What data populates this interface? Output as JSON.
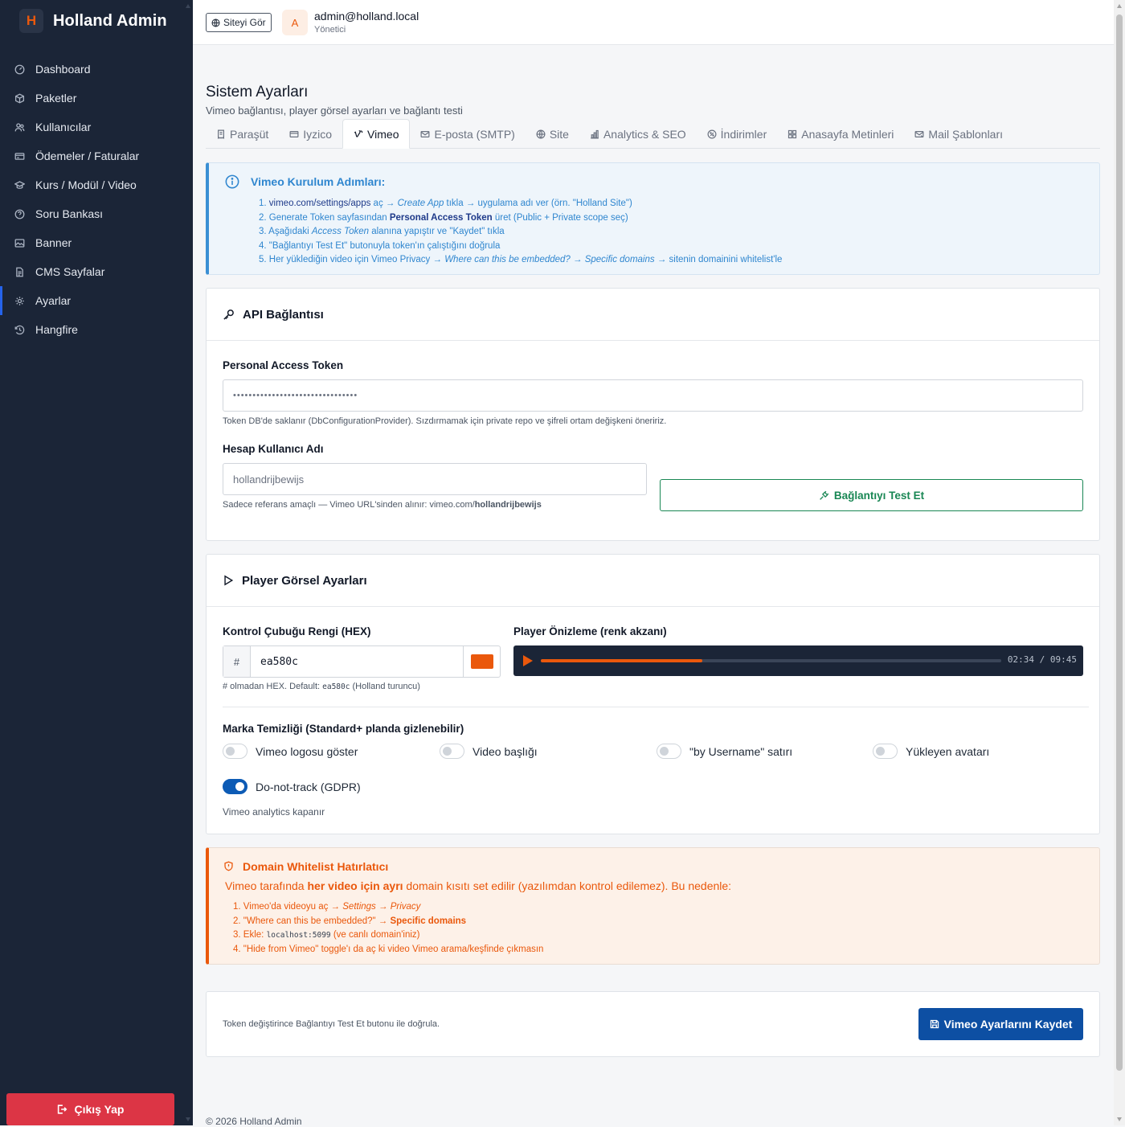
{
  "brand": {
    "logo_letter": "H",
    "name": "Holland Admin"
  },
  "sidebar": {
    "items": [
      {
        "label": "Dashboard",
        "icon": "speedometer-icon"
      },
      {
        "label": "Paketler",
        "icon": "box-icon"
      },
      {
        "label": "Kullanıcılar",
        "icon": "users-icon"
      },
      {
        "label": "Ödemeler / Faturalar",
        "icon": "credit-card-icon"
      },
      {
        "label": "Kurs / Modül / Video",
        "icon": "mortarboard-icon"
      },
      {
        "label": "Soru Bankası",
        "icon": "question-circle-icon"
      },
      {
        "label": "Banner",
        "icon": "image-icon"
      },
      {
        "label": "CMS Sayfalar",
        "icon": "file-text-icon"
      },
      {
        "label": "Ayarlar",
        "icon": "gear-icon",
        "active": true
      },
      {
        "label": "Hangfire",
        "icon": "clock-history-icon"
      }
    ],
    "logout_label": "Çıkış Yap"
  },
  "topbar": {
    "view_site_label": "Siteyi Gör",
    "avatar_letter": "A",
    "user_email": "admin@holland.local",
    "user_role": "Yönetici"
  },
  "page": {
    "title": "Sistem Ayarları",
    "subtitle": "Vimeo bağlantısı, player görsel ayarları ve bağlantı testi"
  },
  "tabs": [
    {
      "label": "Paraşüt",
      "icon": "receipt-icon"
    },
    {
      "label": "Iyzico",
      "icon": "credit-card-icon"
    },
    {
      "label": "Vimeo",
      "icon": "vimeo-icon",
      "active": true
    },
    {
      "label": "E-posta (SMTP)",
      "icon": "envelope-icon"
    },
    {
      "label": "Site",
      "icon": "globe-icon"
    },
    {
      "label": "Analytics & SEO",
      "icon": "bar-chart-icon"
    },
    {
      "label": "İndirimler",
      "icon": "percent-icon"
    },
    {
      "label": "Anasayfa Metinleri",
      "icon": "grid-icon"
    },
    {
      "label": "Mail Şablonları",
      "icon": "envelope-paper-icon"
    }
  ],
  "info": {
    "title": "Vimeo Kurulum Adımları:",
    "steps": {
      "s1": {
        "n": "1. ",
        "link": "vimeo.com/settings/apps",
        "a": " aç → ",
        "em": "Create App",
        "b": " tıkla → uygulama adı ver (örn. \"Holland Site\")"
      },
      "s2": {
        "n": "2. ",
        "a": "Generate Token sayfasından ",
        "strong": "Personal Access Token",
        "b": " üret (Public + Private scope seç)"
      },
      "s3": {
        "n": "3. ",
        "a": "Aşağıdaki ",
        "em": "Access Token",
        "b": " alanına yapıştır ve \"Kaydet\" tıkla"
      },
      "s4": {
        "n": "4. ",
        "a": "\"Bağlantıyı Test Et\" butonuyla token'ın çalıştığını doğrula"
      },
      "s5": {
        "n": "5. ",
        "a": "Her yüklediğin video için Vimeo Privacy → ",
        "em": "Where can this be embedded? → Specific domains",
        "b": " → sitenin domainini whitelist'le"
      }
    }
  },
  "api": {
    "title": "API Bağlantısı",
    "token_label": "Personal Access Token",
    "token_value": "••••••••••••••••••••••••••••••••",
    "token_hint": "Token DB'de saklanır (DbConfigurationProvider). Sızdırmamak için private repo ve şifreli ortam değişkeni öneririz.",
    "username_label": "Hesap Kullanıcı Adı",
    "username_value": "hollandrijbewijs",
    "username_hint_prefix": "Sadece referans amaçlı — Vimeo URL'sinden alınır: vimeo.com/",
    "username_hint_bold": "hollandrijbewijs",
    "test_button": "Bağlantıyı Test Et"
  },
  "player": {
    "title": "Player Görsel Ayarları",
    "color_label": "Kontrol Çubuğu Rengi (HEX)",
    "hex_prefix": "#",
    "hex_value": "ea580c",
    "swatch_color": "#ea580c",
    "hex_hint_a": "# olmadan HEX. Default: ",
    "hex_hint_code": "ea580c",
    "hex_hint_b": " (Holland turuncu)",
    "preview_label": "Player Önizleme (renk akzanı)",
    "preview_time": "02:34 / 09:45",
    "preview_progress": 0.35,
    "brand_title": "Marka Temizliği (Standard+ planda gizlenebilir)",
    "toggles": [
      {
        "label": "Vimeo logosu göster",
        "on": false
      },
      {
        "label": "Video başlığı",
        "on": false
      },
      {
        "label": "\"by Username\" satırı",
        "on": false
      },
      {
        "label": "Yükleyen avatarı",
        "on": false
      }
    ],
    "dnt_label": "Do-not-track (GDPR)",
    "dnt_on": true,
    "dnt_hint": "Vimeo analytics kapanır"
  },
  "whitelist": {
    "title": "Domain Whitelist Hatırlatıcı",
    "text_a": "Vimeo tarafında ",
    "text_bold": "her video için ayrı",
    "text_b": " domain kısıtı set edilir (yazılımdan kontrol edilemez). Bu nedenle:",
    "steps": {
      "s1": {
        "n": "1. ",
        "a": "Vimeo'da videoyu aç → ",
        "em": "Settings → Privacy"
      },
      "s2": {
        "n": "2. ",
        "a": "\"Where can this be embedded?\" → ",
        "strong": "Specific domains"
      },
      "s3": {
        "n": "3. ",
        "a": "Ekle: ",
        "code": "localhost:5099",
        "b": " (ve canlı domain'iniz)"
      },
      "s4": {
        "n": "4. ",
        "a": "\"Hide from Vimeo\" toggle'ı da aç ki video Vimeo arama/keşfinde çıkmasın"
      }
    }
  },
  "savebar": {
    "hint": "Token değiştirince Bağlantıyı Test Et butonu ile doğrula.",
    "button": "Vimeo Ayarlarını Kaydet"
  },
  "footer": {
    "text": "© 2026 Holland Admin"
  }
}
